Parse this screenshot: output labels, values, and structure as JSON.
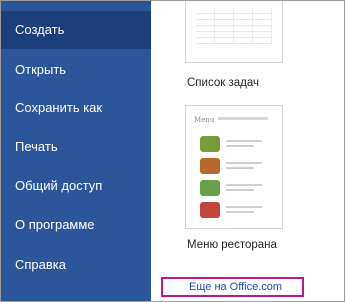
{
  "sidebar": {
    "items": [
      {
        "label": "Создать",
        "active": true
      },
      {
        "label": "Открыть"
      },
      {
        "label": "Сохранить как"
      },
      {
        "label": "Печать"
      },
      {
        "label": "Общий доступ"
      },
      {
        "label": "О программе"
      },
      {
        "label": "Справка"
      }
    ],
    "background": "#2b579a",
    "active_background": "#1a3f7a"
  },
  "templates": [
    {
      "caption": "Список задач"
    },
    {
      "caption": "Меню ресторана"
    }
  ],
  "menu_thumbnail": {
    "title": "Menu"
  },
  "more_link": {
    "label": "Еще на Office.com",
    "highlight_color": "#c0168c"
  }
}
